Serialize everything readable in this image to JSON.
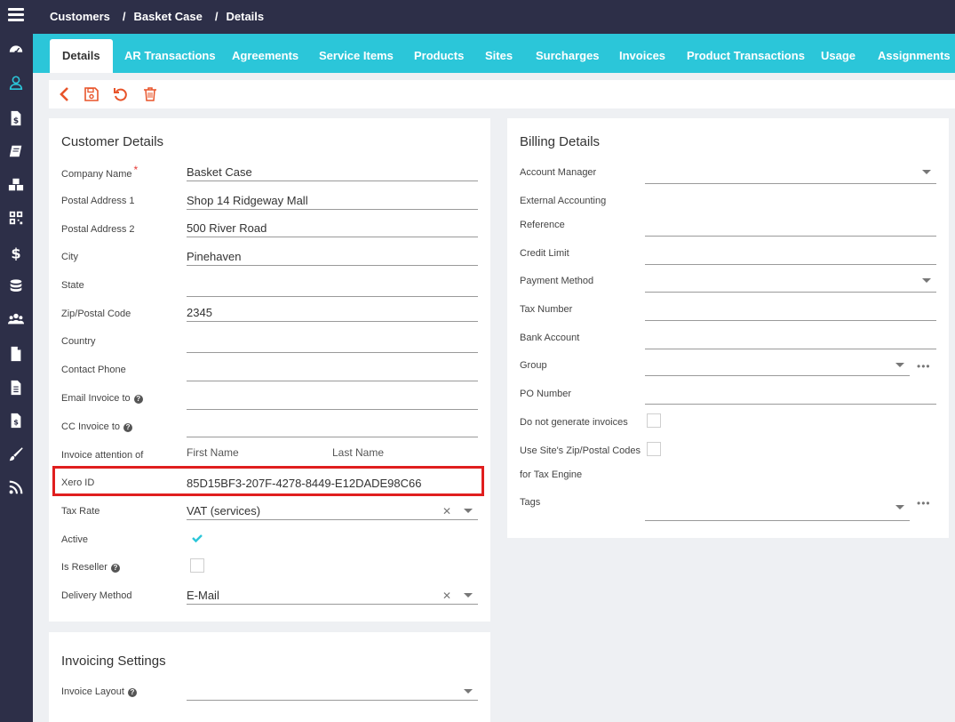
{
  "breadcrumb": {
    "items": [
      "Customers",
      "Basket Case",
      "Details"
    ],
    "separator": "/"
  },
  "tabs": [
    "Details",
    "AR Transactions",
    "Agreements",
    "Service Items",
    "Products",
    "Sites",
    "Surcharges",
    "Invoices",
    "Product Transactions",
    "Usage",
    "Assignments"
  ],
  "toolbar": {
    "icons": [
      "back-icon",
      "save-icon",
      "undo-icon",
      "delete-icon"
    ]
  },
  "customer": {
    "title": "Customer Details",
    "company_name_label": "Company Name",
    "required_mark": "*",
    "company_name": "Basket Case",
    "postal1_label": "Postal Address 1",
    "postal1": "Shop 14 Ridgeway Mall",
    "postal2_label": "Postal Address 2",
    "postal2": "500 River Road",
    "city_label": "City",
    "city": "Pinehaven",
    "state_label": "State",
    "state": "",
    "zip_label": "Zip/Postal Code",
    "zip": "2345",
    "country_label": "Country",
    "country": "",
    "phone_label": "Contact Phone",
    "phone": "",
    "email_label": "Email Invoice to",
    "cc_label": "CC Invoice to",
    "attention_label": "Invoice attention of",
    "first_name_placeholder": "First Name",
    "last_name_placeholder": "Last Name",
    "xero_label": "Xero ID",
    "xero_id": "85D15BF3-207F-4278-8449-E12DADE98C66",
    "tax_label": "Tax Rate",
    "tax_rate": "VAT (services)",
    "active_label": "Active",
    "active": true,
    "reseller_label": "Is Reseller",
    "reseller": false,
    "delivery_label": "Delivery Method",
    "delivery": "E-Mail",
    "clear_glyph": "✕",
    "help_glyph": "?"
  },
  "invoicing": {
    "title": "Invoicing Settings",
    "layout_label": "Invoice Layout"
  },
  "billing": {
    "title": "Billing Details",
    "account_manager_label": "Account Manager",
    "ext_ref_label_1": "External Accounting",
    "ext_ref_label_2": "Reference",
    "credit_limit_label": "Credit Limit",
    "payment_method_label": "Payment Method",
    "tax_number_label": "Tax Number",
    "bank_account_label": "Bank Account",
    "group_label": "Group",
    "po_label": "PO Number",
    "no_invoices_label": "Do not generate invoices",
    "zip_tax_label_1": "Use Site's Zip/Postal Codes",
    "zip_tax_label_2": "for Tax Engine",
    "tags_label": "Tags",
    "more_glyph": "•••"
  },
  "colors": {
    "nav": "#2d2f48",
    "accent": "#2bc6d9",
    "toolbar_icon": "#e8542a",
    "highlight": "#e01e1e",
    "check": "#2bc6d9"
  }
}
